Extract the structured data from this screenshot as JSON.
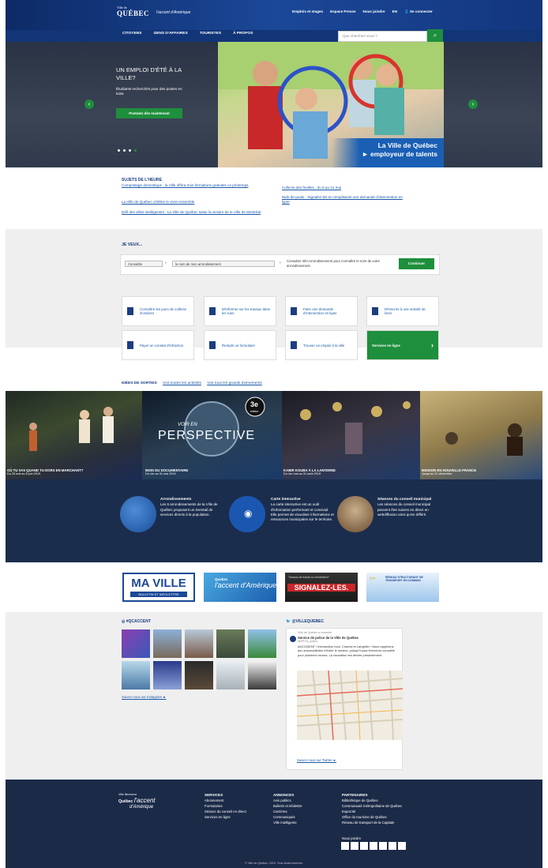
{
  "header": {
    "logo_small": "Ville de",
    "logo_big": "QUÉBEC",
    "accent_logo": "l'accent d'Amérique",
    "top_links": [
      "Emplois et stages",
      "Espace Presse",
      "Nous joindre",
      "EN",
      "Se connecter"
    ],
    "nav": [
      "CITOYENS",
      "GENS D'AFFAIRES",
      "TOURISTES",
      "À PROPOS"
    ],
    "search_placeholder": "Que cherchez-vous ?"
  },
  "hero": {
    "title": "UN EMPLOI D'ÉTÉ À LA VILLE?",
    "subtitle": "Étudiants recherchés pour des postes en loisir.",
    "button": "Postulez dès maintenant",
    "band_line1": "La Ville de Québec",
    "band_line2": "► employeur de talents"
  },
  "subjects": {
    "heading": "SUJETS DE L'HEURE",
    "left": [
      "Compostage domestique : la Ville offrira trois formations gratuites ce printemps",
      "La Ville de Québec célèbre le vivre-ensemble",
      "Défi des villes intelligentes : La Ville de Québec salue la victoire de la Ville de Montréal"
    ],
    "right": [
      "Collecte des feuilles : du 6 au 31 mai",
      "Nids-de-poule : Signalez-les en remplissant une demande d'intervention en ligne"
    ]
  },
  "je_veux": {
    "heading": "JE VEUX...",
    "select1": "Connaître",
    "select2": "le nom de mon arrondissement",
    "desc": "Consulter Info-Arrondissement pour connaître le nom de votre arrondissement.",
    "continue": "Continuer",
    "cards": [
      "Connaître les jours de collecte d'ordures",
      "M'informer sur les travaux dans les rues",
      "Faire une demande d'intervention en ligne",
      "M'inscrire à une activité de loisir",
      "Payer un constat d'infraction",
      "Remplir un formulaire",
      "Trouver un emploi à la ville",
      "Services en ligne"
    ]
  },
  "sorties": {
    "heading": "IDÉES DE SORTIES",
    "link1": "Voir toutes les activités",
    "link2": "Voir tous les grands événements",
    "panels": [
      {
        "title": "OÙ TU VAS QUAND TU DORS EN MARCHANT?",
        "date": "Du 23 mai au 8 juin 2019"
      },
      {
        "title": "MOIS DU DOCUMENTAIRE",
        "date": "Du 1er au 31 mai 2019"
      },
      {
        "title": "KABIR KOUBA À LA LANTERNE",
        "date": "Du 1er mai au 31 août 2019"
      },
      {
        "title": "MISSION EN NOUVELLE-FRANCE",
        "date": "Jusqu'au 31 décembre"
      }
    ],
    "doc_title": "PERSPECTIVE",
    "doc_sub": "VOIR EN",
    "doc_edition": "3e",
    "doc_edition_word": "édition"
  },
  "info": [
    {
      "title": "Arrondissements",
      "text": "Les 6 arrondissements de la Ville de Québec proposent un éventail de services directs à la population."
    },
    {
      "title": "Carte interactive",
      "text": "La carte interactive est un outil d'information performant et convivial. Elle permet de visualiser informations et ressources municipales sur le territoire."
    },
    {
      "title": "Séances du conseil municipal",
      "text": "Les séances du conseil municipal peuvent être suivies en direct en webdiffusion ainsi qu'en différé."
    }
  ],
  "banners": {
    "maville": "MA VILLE",
    "maville_sub": "BULLETIN ET INFOLETTRE",
    "accent": "l'accent d'Amérique",
    "accent_pre": "Quebec",
    "signalez": "SIGNALEZ-LES.",
    "signalez_pre": "Travaux de travail ou d'entretien?",
    "rtc": "RÉSEAU STRUCTURANT DE TRANSPORT EN COMMUN"
  },
  "social": {
    "insta_heading": "#QCACCENT",
    "insta_link": "Suivez-nous sur Instagram ►",
    "twitter_heading": "@VILLEQUEBEC",
    "tweet_retweet": "Ville de Québec a retweeté",
    "tweet_author": "Service de police de la Ville de Québec",
    "tweet_handle": "@SPVQ_police",
    "tweet_text": "#ACCIDENT ! Intersection boul. Charest et Langelier ! Nous rappelons aux automobilistes d'éviter le secteur, puisqu'il aura fermeture complète pour plusieurs heures. La circulation est déviée présentement.",
    "twitter_link": "Suivez-nous sur Twitter ►"
  },
  "footer": {
    "logo_small": "Ville fièrement",
    "logo_brand": "Québec",
    "logo_accent": "l'accent",
    "logo_sub": "d'Amérique",
    "cols": [
      {
        "title": "SERVICES",
        "items": [
          "Abonnement",
          "Formulaires",
          "Séance du conseil en direct",
          "Services en ligne"
        ]
      },
      {
        "title": "ANNONCES",
        "items": [
          "Avis publics",
          "Bulletin et infolettre",
          "Carrières",
          "Communiqués",
          "Ville intelligente"
        ]
      },
      {
        "title": "PARTENAIRES",
        "items": [
          "Bibliothèque de Québec",
          "Communauté métropolitaine de Québec",
          "ExpoCité",
          "Office du tourisme de Québec",
          "Réseau de transport de la Capitale"
        ]
      }
    ],
    "join": "Nous joindre",
    "copyright": "© Ville de Québec, 2019. Tous droits réservés."
  },
  "colors": {
    "primary": "#1b4898",
    "green": "#1e8f3c",
    "dark": "#1b2d4d",
    "footer": "#1b2a47"
  }
}
